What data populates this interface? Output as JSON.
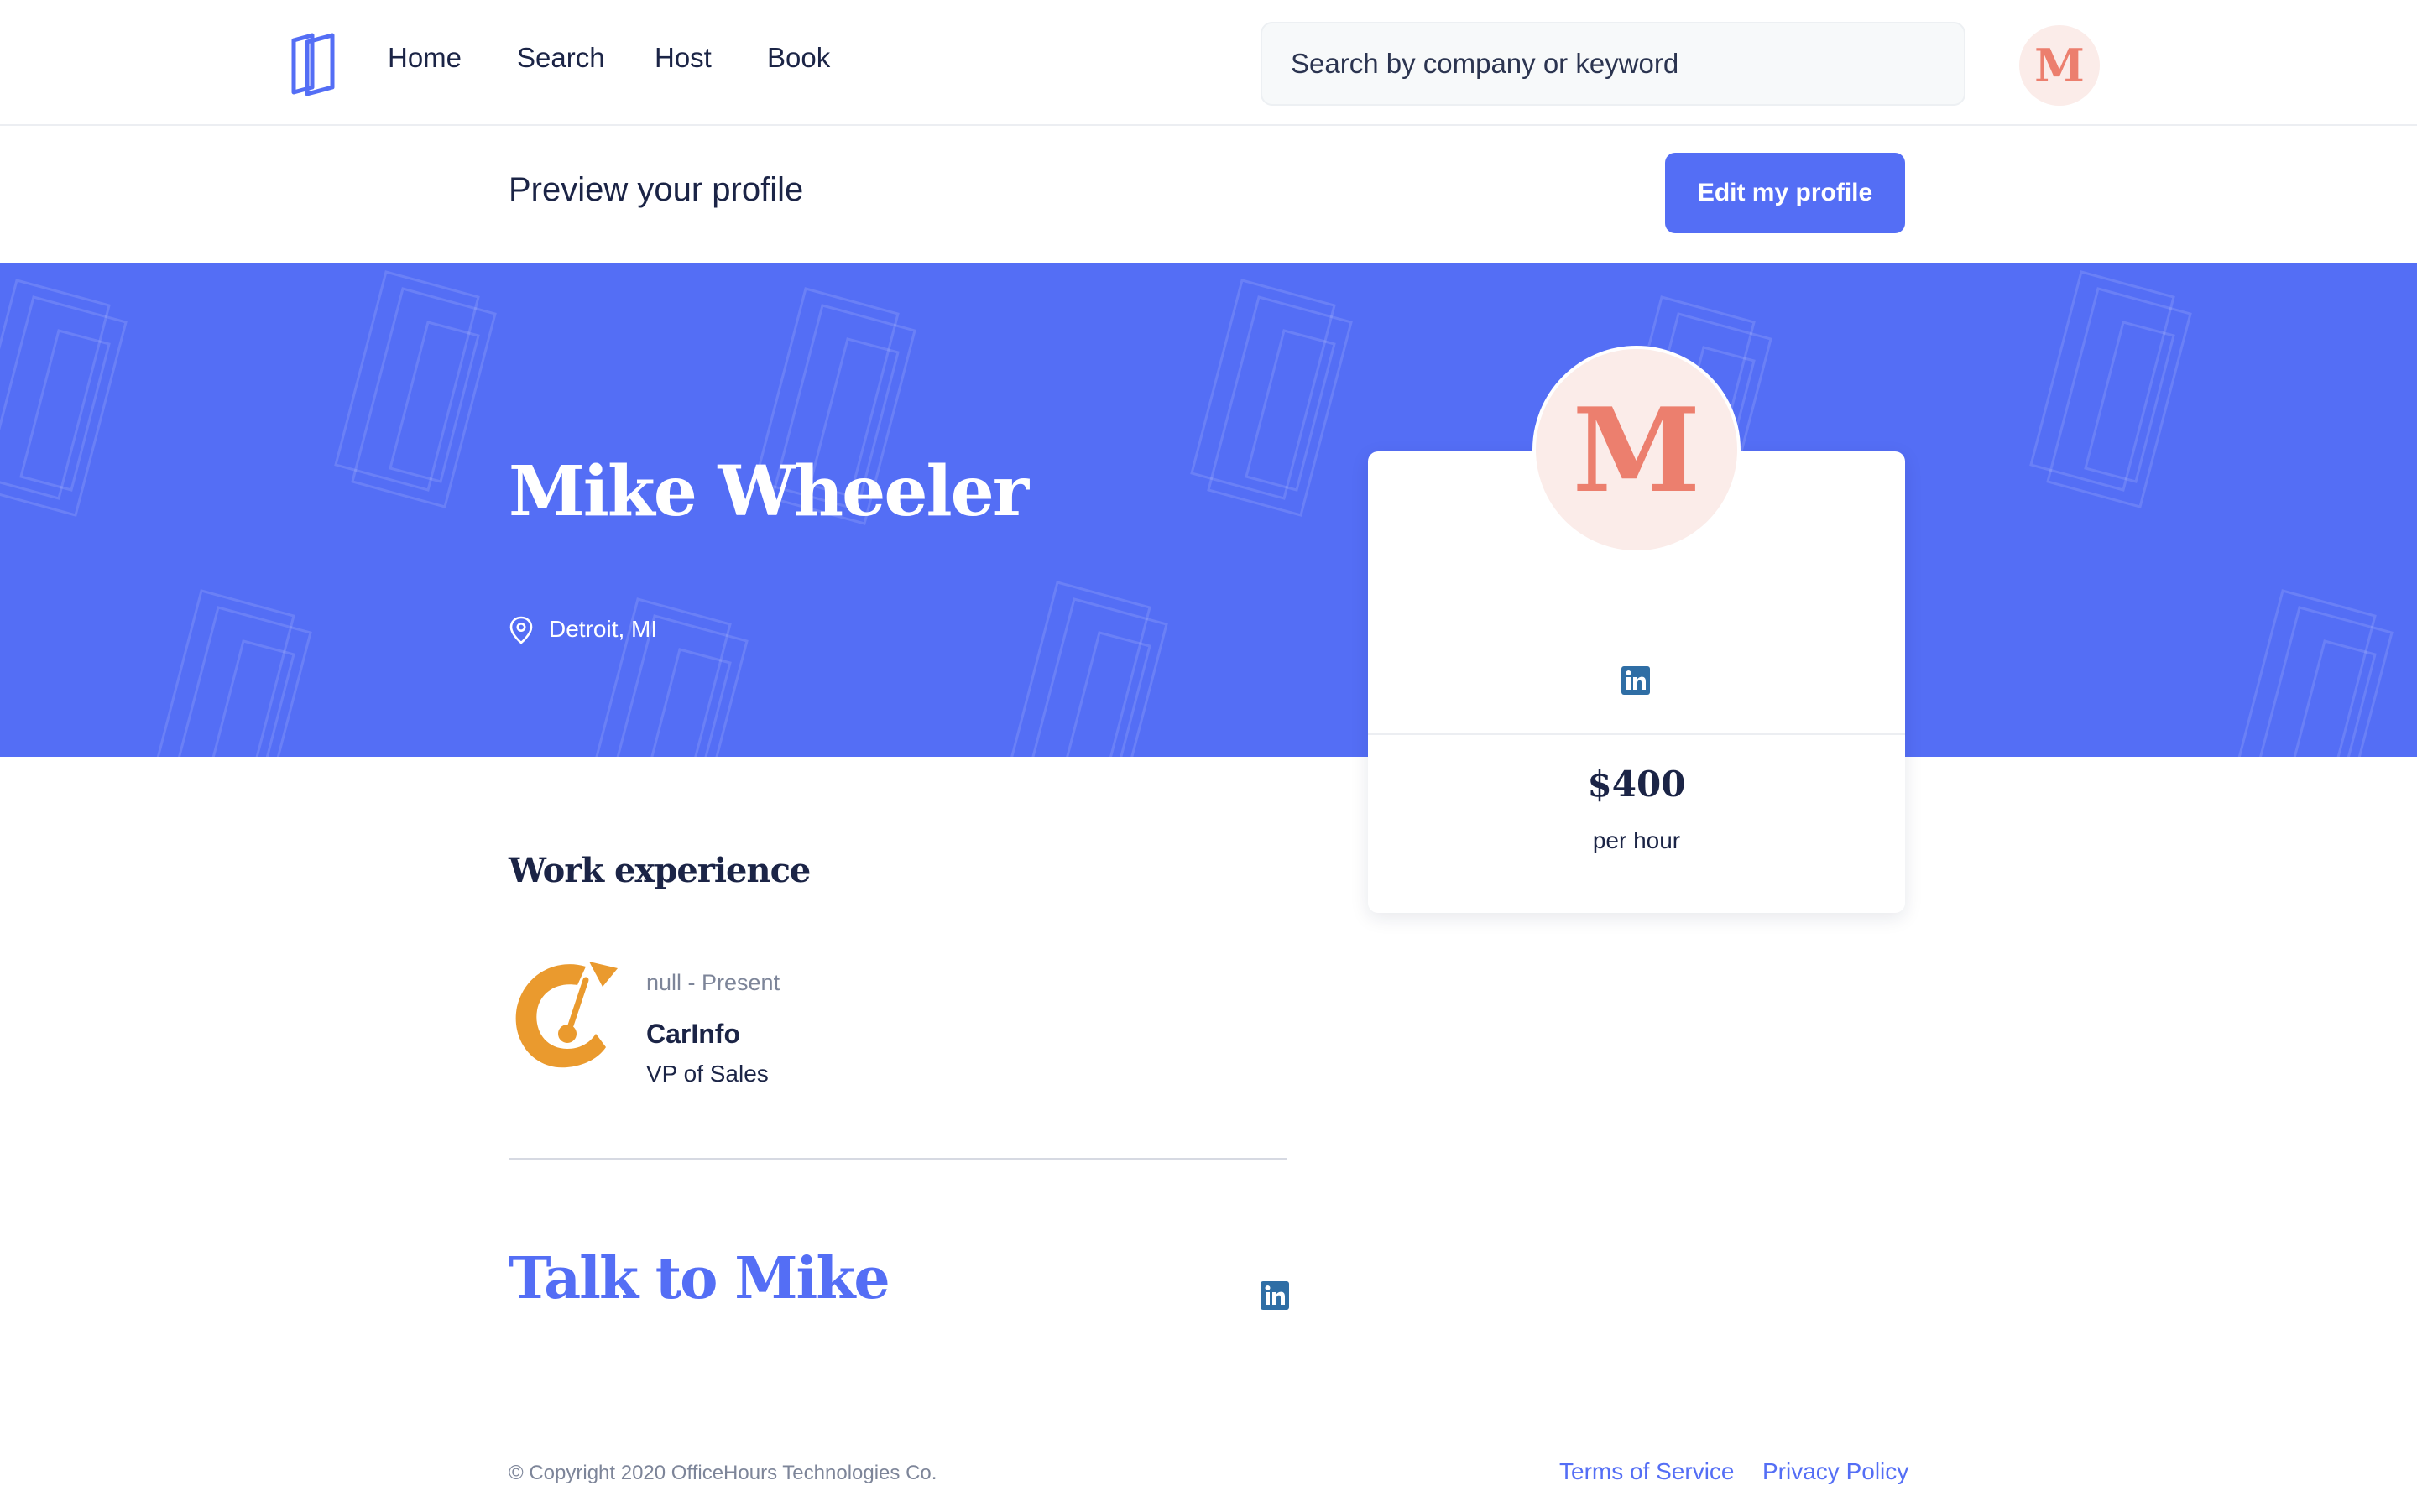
{
  "nav": {
    "links": [
      "Home",
      "Search",
      "Host",
      "Book"
    ],
    "search_placeholder": "Search by company or keyword",
    "avatar_initial": "M",
    "logo_icon": "officehours-logo-icon"
  },
  "preview": {
    "title": "Preview your profile",
    "edit_button": "Edit my profile"
  },
  "profile": {
    "name": "Mike Wheeler",
    "location": "Detroit, MI",
    "avatar_initial": "M",
    "price": "$400",
    "price_unit": "per hour",
    "social_icon": "linkedin-icon"
  },
  "work_experience": {
    "title": "Work experience",
    "items": [
      {
        "dates": "null - Present",
        "company": "CarInfo",
        "role": "VP of Sales",
        "logo_icon": "carinfo-logo-icon"
      }
    ]
  },
  "talk": {
    "title": "Talk to Mike",
    "social_icon": "linkedin-icon"
  },
  "footer": {
    "copyright": "© Copyright 2020 OfficeHours Technologies Co.",
    "terms": "Terms of Service",
    "privacy": "Privacy Policy"
  },
  "colors": {
    "brand_blue": "#546ef5",
    "avatar_bg": "#fbece9",
    "avatar_text": "#ec7f6e",
    "linkedin": "#2f6ea5",
    "carinfo_orange": "#ea9a2e",
    "text_dark": "#1b2446"
  }
}
